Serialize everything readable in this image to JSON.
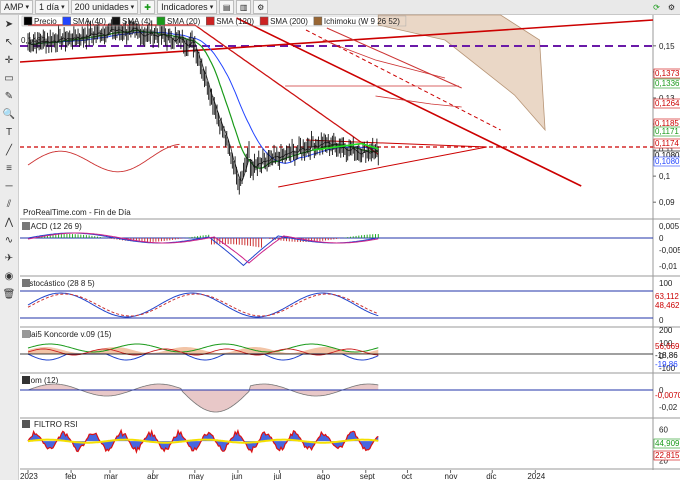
{
  "toolbar": {
    "symbol": "AMP",
    "period": "1 día",
    "units": "200 unidades",
    "indicators_label": "Indicadores"
  },
  "left_tools": [
    "arrow-icon",
    "cursor-icon",
    "crosshair-icon",
    "ruler-icon",
    "pencil-icon",
    "zoom-icon",
    "text-icon",
    "trend-icon",
    "fibonacci-icon",
    "line-icon",
    "channel-icon",
    "pattern-icon",
    "wave-icon",
    "rocket-icon",
    "eye-icon",
    "trash-icon"
  ],
  "price_panel": {
    "legend": [
      {
        "label": "Precio",
        "color": "#000000"
      },
      {
        "label": "SMA (40)",
        "color": "#2244ff"
      },
      {
        "label": "SMA (4)",
        "color": "#111111"
      },
      {
        "label": "SMA (20)",
        "color": "#1a9a1a"
      },
      {
        "label": "SMA (120)",
        "color": "#cc2222"
      },
      {
        "label": "SMA (200)",
        "color": "#cc2222"
      },
      {
        "label": "Ichimoku (W 9 26 52)",
        "color": "#996633"
      }
    ],
    "watermark": "ProRealTime.com - Fin de Día",
    "left_price_label": "0,1482",
    "y_ticks": [
      "0,15",
      "0,14",
      "0,13",
      "0,12",
      "0,11",
      "0,1",
      "0,09"
    ],
    "right_labels": [
      {
        "text": "0,1373",
        "color": "#cc0000"
      },
      {
        "text": "0,1336",
        "color": "#1a9a1a"
      },
      {
        "text": "0,1264",
        "color": "#cc0000"
      },
      {
        "text": "0,1185",
        "color": "#cc0000"
      },
      {
        "text": "0,1171",
        "color": "#1a9a1a"
      },
      {
        "text": "0,1174",
        "color": "#cc0000"
      },
      {
        "text": "0,1080",
        "color": "#000000"
      },
      {
        "text": "0,1080",
        "color": "#2244ff"
      }
    ]
  },
  "panels": {
    "macd": {
      "title": "MACD (12 26 9)",
      "ticks": [
        "0,005",
        "0",
        "-0,005",
        "-0,01"
      ]
    },
    "stoch": {
      "title": "Estocástico (28 8 5)",
      "ticks": [
        "100",
        "0"
      ],
      "right_labels": [
        {
          "text": "63,112",
          "color": "#cc0000"
        },
        {
          "text": "48,462",
          "color": "#cc0000"
        }
      ]
    },
    "blai": {
      "title": "Blai5 Koncorde v.09 (15)",
      "ticks": [
        "200",
        "100",
        "0",
        "-100"
      ],
      "right_labels": [
        {
          "text": "56,669",
          "color": "#cc0000"
        },
        {
          "text": "-18,86",
          "color": "#000000"
        },
        {
          "text": "-19,86",
          "color": "#2244ff"
        }
      ]
    },
    "mom": {
      "title": "Mom (12)",
      "ticks": [
        "0",
        "-0,02"
      ],
      "right_labels": [
        {
          "text": "-0,0070",
          "color": "#cc0000"
        }
      ]
    },
    "rsi": {
      "title": "FILTRO RSI",
      "ticks": [
        "60",
        "40",
        "20"
      ],
      "right_labels": [
        {
          "text": "44,909",
          "color": "#1a9a1a"
        },
        {
          "text": "22,815",
          "color": "#cc0000"
        }
      ]
    }
  },
  "x_axis": [
    "2023",
    "feb",
    "mar",
    "abr",
    "may",
    "jun",
    "jul",
    "ago",
    "sept",
    "oct",
    "nov",
    "dic",
    "2024"
  ],
  "chart_data": {
    "type": "line",
    "x": [
      "2023-01",
      "2023-02",
      "2023-03",
      "2023-04",
      "2023-05",
      "2023-06",
      "2023-07",
      "2023-08",
      "2023-09"
    ],
    "ylim": [
      0.087,
      0.158
    ],
    "series": [
      {
        "name": "Precio",
        "values": [
          0.15,
          0.152,
          0.156,
          0.153,
          0.148,
          0.093,
          0.104,
          0.113,
          0.108
        ]
      },
      {
        "name": "SMA (40)",
        "values": [
          0.151,
          0.152,
          0.154,
          0.154,
          0.15,
          0.114,
          0.108,
          0.111,
          0.108
        ]
      },
      {
        "name": "SMA (20)",
        "values": [
          0.151,
          0.153,
          0.155,
          0.153,
          0.146,
          0.103,
          0.107,
          0.112,
          0.109
        ]
      },
      {
        "name": "SMA (200)",
        "values": [
          0.16,
          0.158,
          0.156,
          0.155,
          0.15,
          0.136,
          0.124,
          0.113,
          0.105
        ]
      }
    ]
  }
}
